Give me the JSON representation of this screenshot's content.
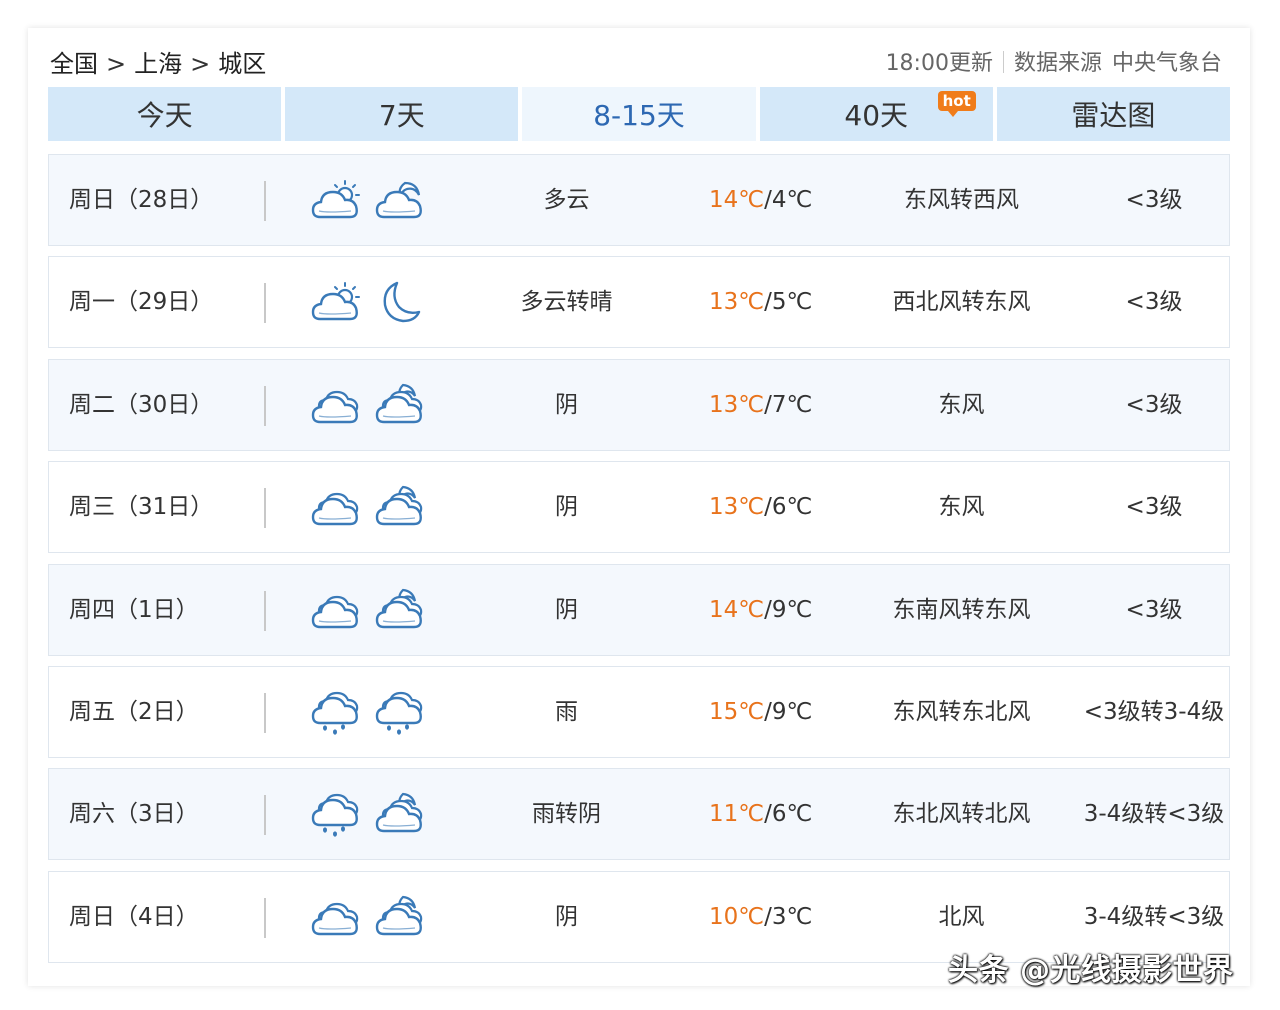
{
  "breadcrumb": [
    "全国",
    "上海",
    "城区"
  ],
  "breadcrumb_sep": ">",
  "source": {
    "update": "18:00更新",
    "label": "数据来源",
    "org": "中央气象台"
  },
  "tabs": [
    {
      "label": "今天",
      "active": false
    },
    {
      "label": "7天",
      "active": false
    },
    {
      "label": "8-15天",
      "active": true
    },
    {
      "label": "40天",
      "active": false,
      "badge": "hot"
    },
    {
      "label": "雷达图",
      "active": false
    }
  ],
  "colors": {
    "high_temp": "#e8731c",
    "active_tab": "#2d68b2",
    "tab_bg": "#d4e8f9",
    "icon_stroke": "#3a7ab8"
  },
  "rows": [
    {
      "date": "周日（28日）",
      "day_icon": "cloud-sun-icon",
      "night_icon": "cloud-moon-icon",
      "cond": "多云",
      "hi": "14℃",
      "lo": "4℃",
      "wind": "东风转西风",
      "level": "<3级"
    },
    {
      "date": "周一（29日）",
      "day_icon": "cloud-sun-icon",
      "night_icon": "moon-icon",
      "cond": "多云转晴",
      "hi": "13℃",
      "lo": "5℃",
      "wind": "西北风转东风",
      "level": "<3级"
    },
    {
      "date": "周二（30日）",
      "day_icon": "overcast-icon",
      "night_icon": "overcast-moon-icon",
      "cond": "阴",
      "hi": "13℃",
      "lo": "7℃",
      "wind": "东风",
      "level": "<3级"
    },
    {
      "date": "周三（31日）",
      "day_icon": "overcast-icon",
      "night_icon": "overcast-moon-icon",
      "cond": "阴",
      "hi": "13℃",
      "lo": "6℃",
      "wind": "东风",
      "level": "<3级"
    },
    {
      "date": "周四（1日）",
      "day_icon": "overcast-icon",
      "night_icon": "overcast-moon-icon",
      "cond": "阴",
      "hi": "14℃",
      "lo": "9℃",
      "wind": "东南风转东风",
      "level": "<3级"
    },
    {
      "date": "周五（2日）",
      "day_icon": "rain-icon",
      "night_icon": "rain-icon",
      "cond": "雨",
      "hi": "15℃",
      "lo": "9℃",
      "wind": "东风转东北风",
      "level": "<3级转3-4级"
    },
    {
      "date": "周六（3日）",
      "day_icon": "rain-icon",
      "night_icon": "overcast-moon-icon",
      "cond": "雨转阴",
      "hi": "11℃",
      "lo": "6℃",
      "wind": "东北风转北风",
      "level": "3-4级转<3级"
    },
    {
      "date": "周日（4日）",
      "day_icon": "overcast-icon",
      "night_icon": "overcast-moon-icon",
      "cond": "阴",
      "hi": "10℃",
      "lo": "3℃",
      "wind": "北风",
      "level": "3-4级转<3级"
    }
  ],
  "watermark": "头条 @光线摄影世界"
}
